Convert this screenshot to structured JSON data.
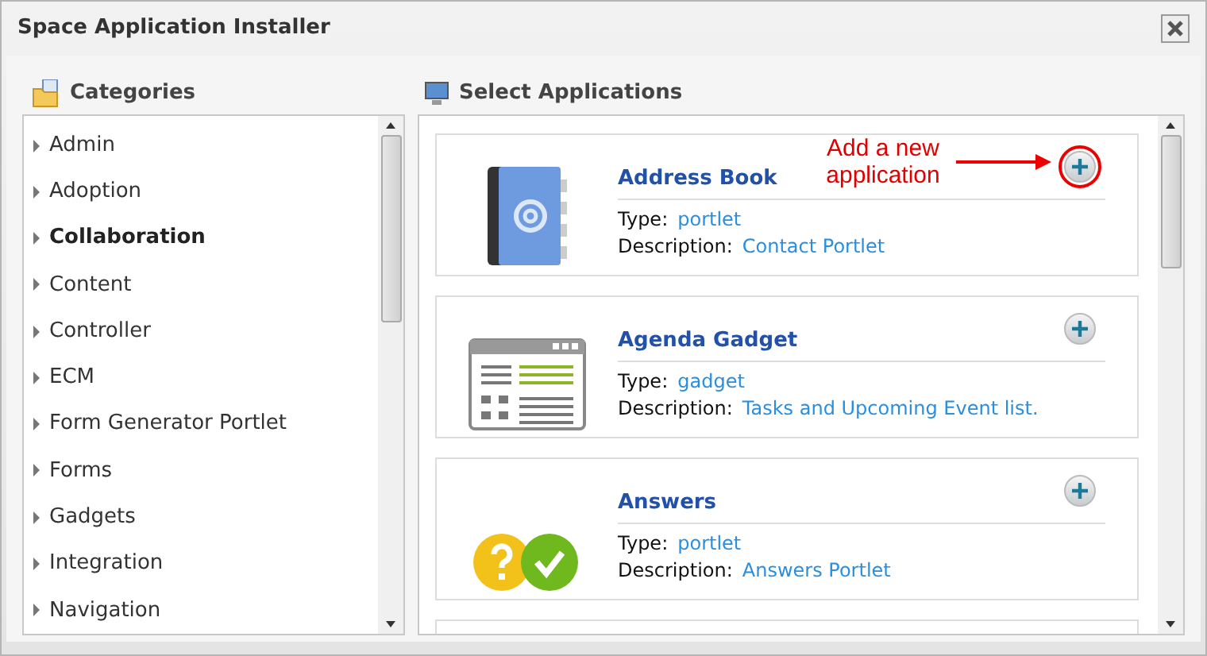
{
  "window": {
    "title": "Space Application Installer"
  },
  "categories": {
    "title": "Categories",
    "items": [
      {
        "label": "Admin",
        "selected": false
      },
      {
        "label": "Adoption",
        "selected": false
      },
      {
        "label": "Collaboration",
        "selected": true
      },
      {
        "label": "Content",
        "selected": false
      },
      {
        "label": "Controller",
        "selected": false
      },
      {
        "label": "ECM",
        "selected": false
      },
      {
        "label": "Form Generator Portlet",
        "selected": false
      },
      {
        "label": "Forms",
        "selected": false
      },
      {
        "label": "Gadgets",
        "selected": false
      },
      {
        "label": "Integration",
        "selected": false
      },
      {
        "label": "Navigation",
        "selected": false
      }
    ]
  },
  "applications": {
    "title": "Select Applications",
    "items": [
      {
        "kind": "book",
        "name": "Address Book",
        "type_label": "Type:",
        "type": "portlet",
        "description_label": "Description:",
        "description": "Contact Portlet",
        "highlighted": true
      },
      {
        "kind": "agenda",
        "name": "Agenda Gadget",
        "type_label": "Type:",
        "type": "gadget",
        "description_label": "Description:",
        "description": "Tasks and Upcoming Event list.",
        "highlighted": false
      },
      {
        "kind": "answers",
        "name": "Answers",
        "type_label": "Type:",
        "type": "portlet",
        "description_label": "Description:",
        "description": "Answers Portlet",
        "highlighted": false
      }
    ]
  },
  "callout": {
    "text": "Add a new application"
  }
}
